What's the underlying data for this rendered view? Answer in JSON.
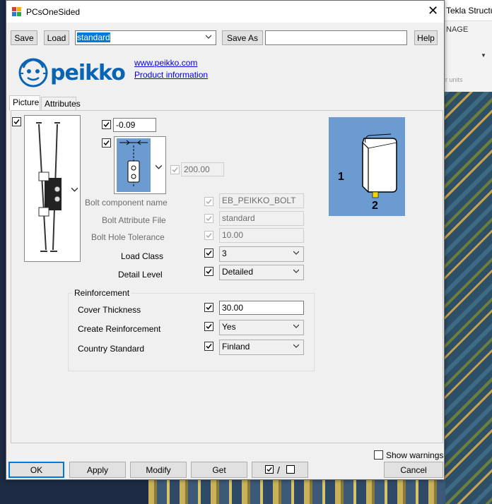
{
  "background_app": {
    "title": "Tekla Structu",
    "ribbon_tab": "NAGE",
    "ribbon_text": "r units"
  },
  "dialog": {
    "title": "PCsOneSided",
    "toolbar": {
      "save_label": "Save",
      "load_label": "Load",
      "preset_value": "standard",
      "save_as_label": "Save As",
      "save_as_value": "",
      "help_label": "Help"
    },
    "links": {
      "website": "www.peikko.com",
      "product_info": "Product information"
    },
    "logo_text": "peikko",
    "tabs": [
      {
        "label": "Picture",
        "active": true
      },
      {
        "label": "Attributes",
        "active": false
      }
    ],
    "picture": {
      "offset_value": "-0.09",
      "spacing_value": "200.00",
      "diagram_labels": {
        "one": "1",
        "two": "2"
      },
      "fields": {
        "bolt_component_name": {
          "label": "Bolt component name",
          "value": "EB_PEIKKO_BOLT"
        },
        "bolt_attribute_file": {
          "label": "Bolt Attribute File",
          "value": "standard"
        },
        "bolt_hole_tolerance": {
          "label": "Bolt Hole Tolerance",
          "value": "10.00"
        },
        "load_class": {
          "label": "Load Class",
          "value": "3"
        },
        "detail_level": {
          "label": "Detail Level",
          "value": "Detailed"
        }
      },
      "reinforcement": {
        "title": "Reinforcement",
        "cover_thickness": {
          "label": "Cover Thickness",
          "value": "30.00"
        },
        "create_reinforcement": {
          "label": "Create Reinforcement",
          "value": "Yes"
        },
        "country_standard": {
          "label": "Country Standard",
          "value": "Finland"
        }
      }
    },
    "show_warnings_label": "Show warnings",
    "footer": {
      "ok_label": "OK",
      "apply_label": "Apply",
      "modify_label": "Modify",
      "get_label": "Get",
      "toggle_separator": "/",
      "cancel_label": "Cancel"
    }
  },
  "colors": {
    "accent": "#0078d7",
    "peikko_blue": "#0a64b4",
    "diagram_bg": "#6b9bd1",
    "diagram_marker": "#f2d800"
  }
}
